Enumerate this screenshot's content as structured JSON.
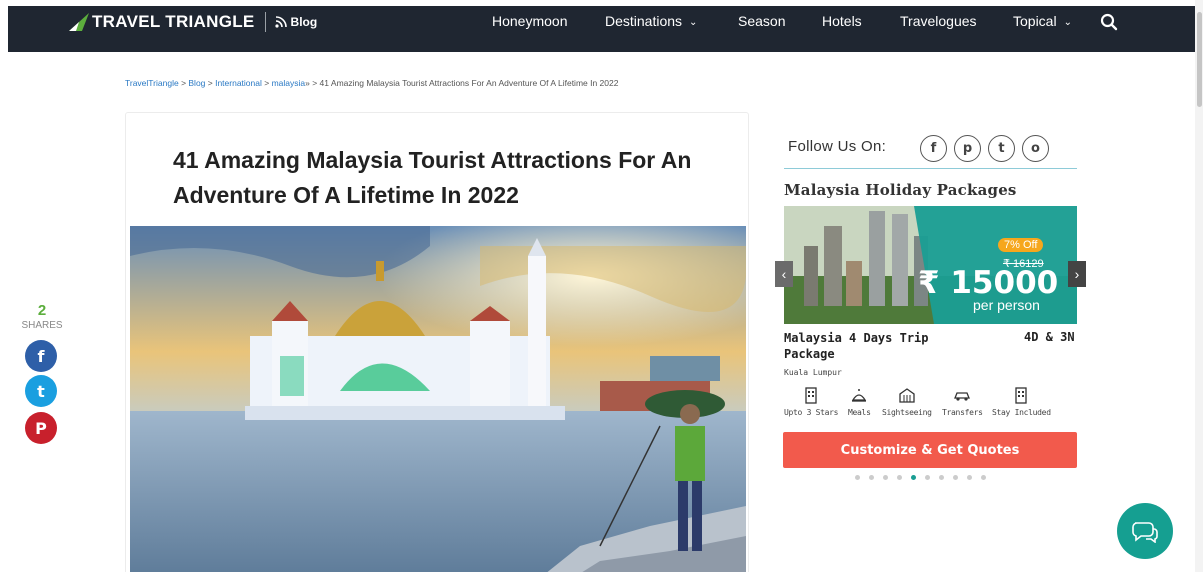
{
  "nav": {
    "logo_text": "TRAVEL TRIANGLE",
    "blog_label": "Blog",
    "items": [
      {
        "label": "Honeymoon"
      },
      {
        "label": "Destinations",
        "chevron": "⌄"
      },
      {
        "label": "Season"
      },
      {
        "label": "Hotels"
      },
      {
        "label": "Travelogues"
      },
      {
        "label": "Topical",
        "chevron": "⌄"
      }
    ],
    "search_icon": "search-icon",
    "bg_color": "#1f2631"
  },
  "breadcrumb": {
    "items": [
      "TravelTriangle",
      "Blog",
      "International",
      "malaysia"
    ],
    "separator": " > ",
    "current": "41 Amazing Malaysia Tourist Attractions For An Adventure Of A Lifetime In 2022"
  },
  "article": {
    "title": "41 Amazing Malaysia Tourist Attractions For An Adventure Of A Lifetime In 2022"
  },
  "share": {
    "count": "2",
    "label": "SHARES",
    "facebook": "f",
    "twitter": "t",
    "pinterest": "P"
  },
  "sidebar": {
    "follow_label": "Follow Us On:",
    "social": [
      "f",
      "p",
      "t",
      "o"
    ],
    "package_heading": "Malaysia Holiday Packages",
    "package": {
      "discount": "7% Off",
      "old_price": "₹ 16129",
      "price": "₹ 15000",
      "per_person": "per person",
      "name": "Malaysia 4 Days Trip Package",
      "duration": "4D & 3N",
      "city": "Kuala Lumpur",
      "features": [
        "Upto 3 Stars",
        "Meals",
        "Sightseeing",
        "Transfers",
        "Stay Included"
      ]
    },
    "cta_label": "Customize & Get Quotes",
    "prev_arrow": "‹",
    "next_arrow": "›",
    "slide_count": 10,
    "active_slide": 5
  },
  "colors": {
    "accent_green": "#5cae3d",
    "cta_red": "#f25a4c",
    "teal": "#159f91",
    "link_blue": "#2a79c4"
  }
}
